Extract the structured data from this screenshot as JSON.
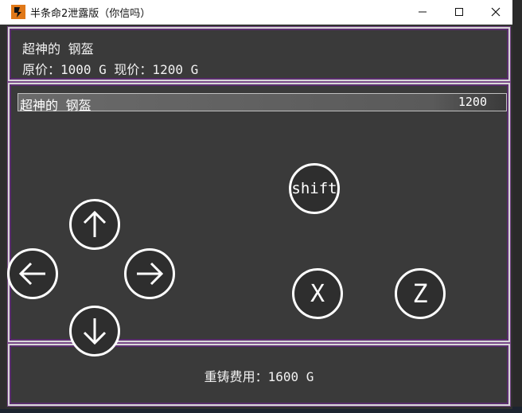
{
  "window": {
    "title": "半条命2泄露版（你信吗）",
    "icon": "app-logo-icon"
  },
  "item_panel": {
    "name": "超神的 钢盔",
    "price_line": "原价：1000 G  现价：1200 G"
  },
  "list": {
    "items": [
      {
        "name": "超神的 钢盔",
        "price": "1200",
        "selected": true
      }
    ]
  },
  "controls": {
    "up": "arrow-up-icon",
    "down": "arrow-down-icon",
    "left": "arrow-left-icon",
    "right": "arrow-right-icon",
    "shift_label": "shift",
    "x_label": "X",
    "z_label": "Z"
  },
  "footer": {
    "reforge_cost": "重铸费用：1600 G"
  },
  "colors": {
    "panel_bg": "#3a3a3a",
    "panel_border": "#d8d8d8",
    "panel_inner": "#5a2d6e",
    "text": "#f2f2f2"
  }
}
